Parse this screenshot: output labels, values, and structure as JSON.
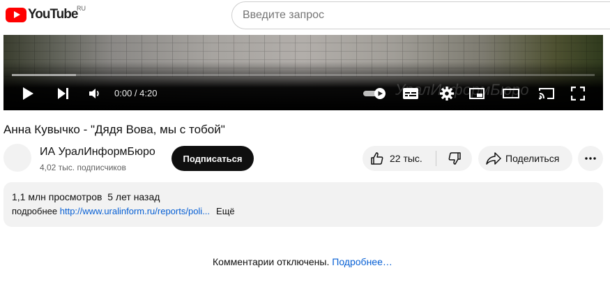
{
  "header": {
    "logo_text": "YouTube",
    "region": "RU",
    "search_placeholder": "Введите запрос"
  },
  "player": {
    "time": "0:00 / 4:20",
    "watermark": "УралИнформБюро",
    "played_fraction": 0.0,
    "loaded_fraction": 0.11,
    "icons": [
      "play-icon",
      "next-icon",
      "volume-icon",
      "autoplay-toggle",
      "subtitles-icon",
      "settings-icon",
      "miniplayer-icon",
      "theater-icon",
      "cast-icon",
      "fullscreen-icon"
    ]
  },
  "video": {
    "title": "Анна Кувычко - \"Дядя Вова, мы с тобой\""
  },
  "channel": {
    "name": "ИА УралИнформБюро",
    "subscribers": "4,02 тыс. подписчиков",
    "subscribe_label": "Подписаться"
  },
  "actions": {
    "likes": "22 тыс.",
    "share_label": "Поделиться"
  },
  "description": {
    "stats": "1,1 млн просмотров  5 лет назад",
    "prefix": "подробнее ",
    "link": "http://www.uralinform.ru/reports/poli...",
    "more": "Ещё"
  },
  "comments": {
    "text": "Комментарии отключены. ",
    "link": "Подробнее…"
  },
  "colors": {
    "brand_red": "#ff0000",
    "link_blue": "#065fd4",
    "chip_gray": "#f2f2f2",
    "subscribe_black": "#0f0f0f"
  }
}
